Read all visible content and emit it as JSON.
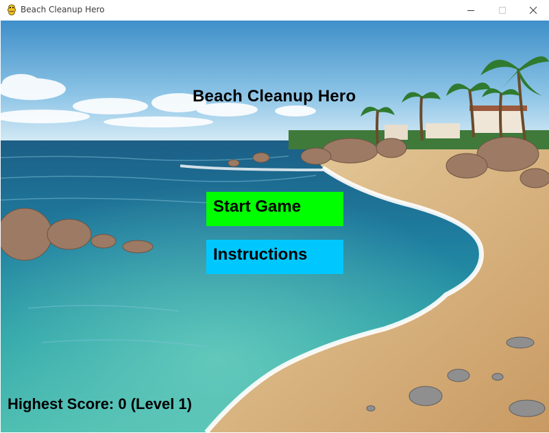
{
  "window": {
    "title": "Beach Cleanup Hero",
    "icon": "pygame-snake-icon",
    "controls": [
      "minimize-icon",
      "maximize-icon",
      "close-icon"
    ]
  },
  "game": {
    "title": "Beach Cleanup Hero",
    "buttons": {
      "start": {
        "label": "Start Game",
        "color": "#00ff00"
      },
      "instructions": {
        "label": "Instructions",
        "color": "#00c8ff"
      }
    },
    "high_score": "Highest Score: 0 (Level 1)",
    "background": "tropical-beach-scene"
  }
}
